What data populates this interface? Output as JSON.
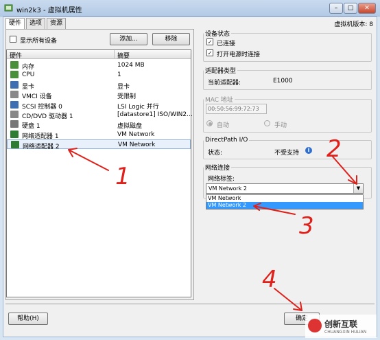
{
  "window": {
    "title": "win2k3 - 虚拟机属性",
    "version": "虚拟机版本: 8"
  },
  "tabs": [
    {
      "label": "硬件"
    },
    {
      "label": "选项"
    },
    {
      "label": "资源"
    }
  ],
  "hardware": {
    "show_all_label": "显示所有设备",
    "add_button": "添加...",
    "remove_button": "移除",
    "col_hardware": "硬件",
    "col_summary": "摘要",
    "rows": [
      {
        "name": "内存",
        "summary": "1024 MB",
        "icon": "memory-icon",
        "icon_color": "#4a8f3a"
      },
      {
        "name": "CPU",
        "summary": "1",
        "icon": "cpu-icon",
        "icon_color": "#4a8f3a"
      },
      {
        "name": "显卡",
        "summary": "显卡",
        "icon": "display-icon",
        "icon_color": "#3e6fb0"
      },
      {
        "name": "VMCI 设备",
        "summary": "受限制",
        "icon": "vmci-icon",
        "icon_color": "#888888"
      },
      {
        "name": "SCSI 控制器 0",
        "summary": "LSI Logic 并行",
        "icon": "scsi-icon",
        "icon_color": "#3e6fb0"
      },
      {
        "name": "CD/DVD 驱动器 1",
        "summary": "[datastore1] ISO/WIN2...",
        "icon": "cd-icon",
        "icon_color": "#888888"
      },
      {
        "name": "硬盘 1",
        "summary": "虚拟磁盘",
        "icon": "disk-icon",
        "icon_color": "#777777"
      },
      {
        "name": "网络适配器 1",
        "summary": "VM Network",
        "icon": "network-icon",
        "icon_color": "#2f7d32"
      },
      {
        "name": "网络适配器 2",
        "summary": "VM Network",
        "icon": "network-icon",
        "icon_color": "#2f7d32"
      }
    ]
  },
  "device_status": {
    "legend": "设备状态",
    "connected": "已连接",
    "connect_on_power": "打开电源时连接"
  },
  "adapter_type": {
    "legend": "适配器类型",
    "label": "当前适配器:",
    "value": "E1000"
  },
  "mac": {
    "legend": "MAC 地址",
    "value": "00:50:56:99:72:73",
    "auto": "自动",
    "manual": "手动"
  },
  "directpath": {
    "legend": "DirectPath I/O",
    "label": "状态:",
    "value": "不受支持"
  },
  "network": {
    "legend": "网络连接",
    "label": "网络标签:",
    "selected": "VM Network 2",
    "options": [
      "VM Network",
      "VM Network 2"
    ]
  },
  "footer": {
    "help": "帮助(H)",
    "ok": "确定"
  },
  "annotations": [
    "1",
    "2",
    "3",
    "4"
  ],
  "watermark": {
    "text": "创新互联",
    "sub": "CHUANGXIN HULIAN"
  },
  "colors": {
    "selection": "#3399ff",
    "arrow": "#e0201a"
  }
}
